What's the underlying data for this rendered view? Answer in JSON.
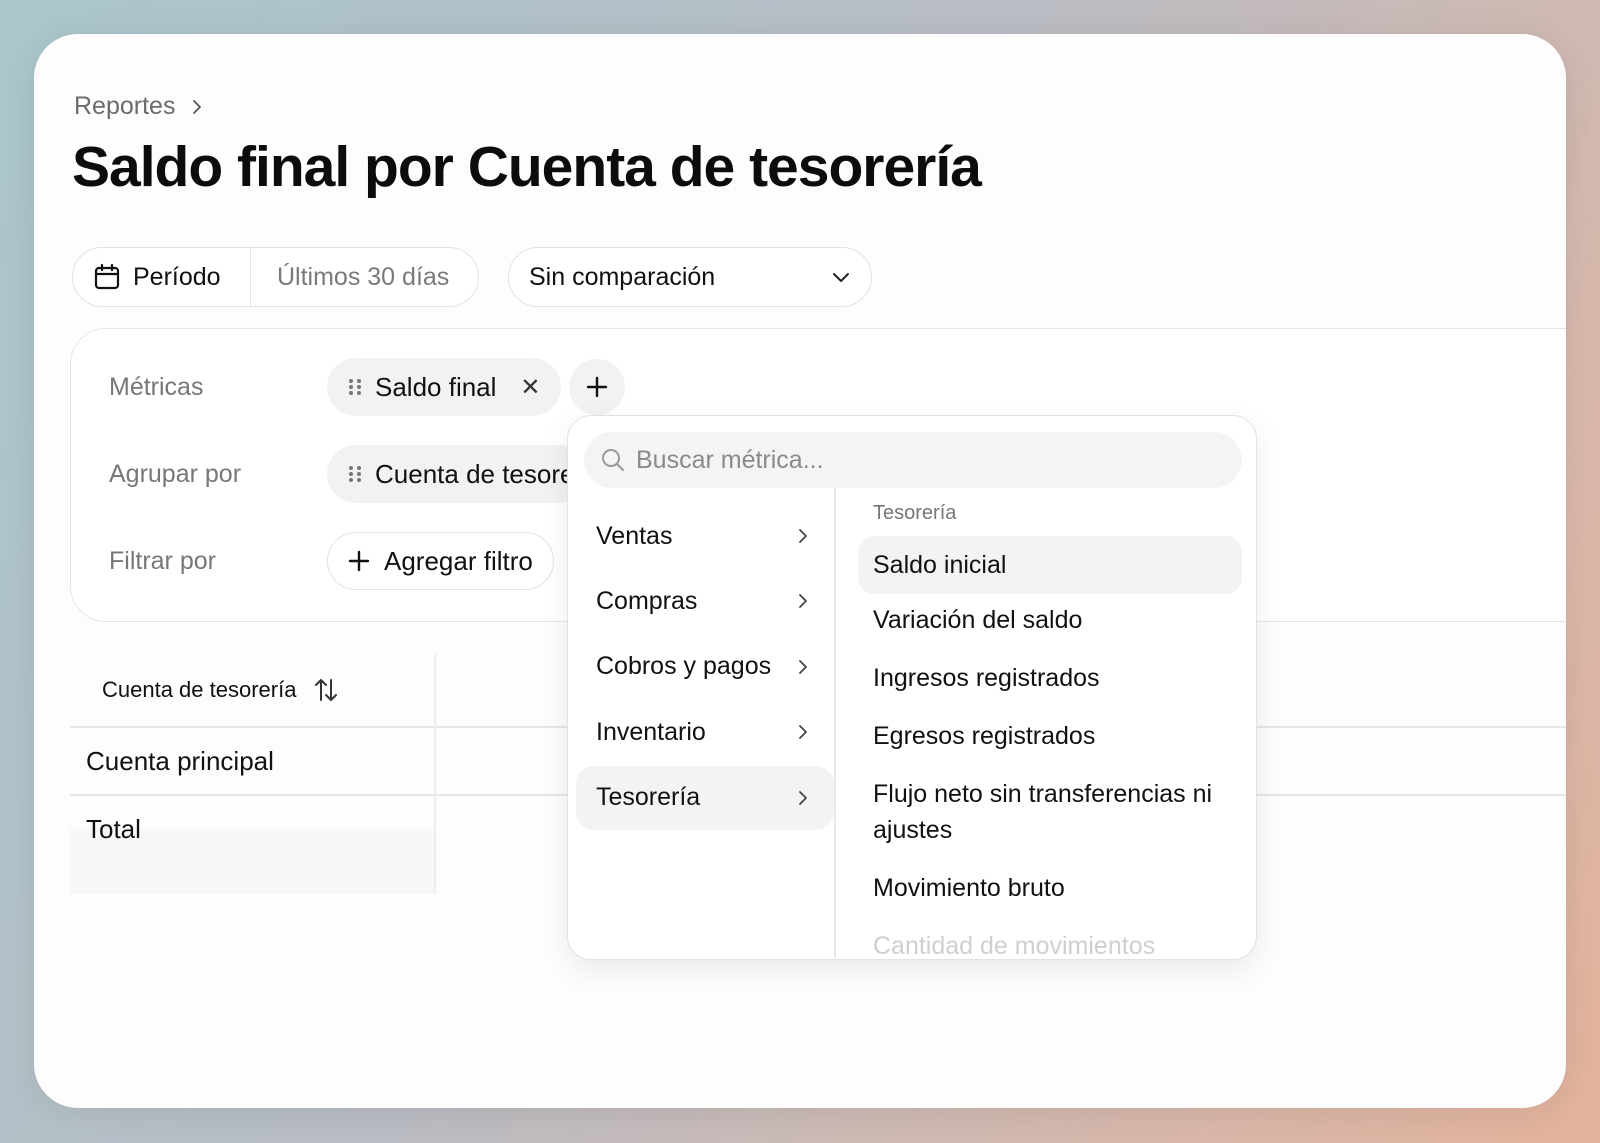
{
  "breadcrumb": {
    "parent": "Reportes"
  },
  "page": {
    "title": "Saldo final por Cuenta de tesorería"
  },
  "period": {
    "label": "Período",
    "value": "Últimos 30 días"
  },
  "comparison": {
    "value": "Sin comparación"
  },
  "config": {
    "metrics_label": "Métricas",
    "group_label": "Agrupar por",
    "filter_label": "Filtrar por",
    "metric_chip": "Saldo final",
    "group_chip": "Cuenta de tesorería",
    "add_filter": "Agregar filtro"
  },
  "table": {
    "header": "Cuenta de tesorería",
    "rows": [
      "Cuenta principal",
      "Total"
    ]
  },
  "dropdown": {
    "search_placeholder": "Buscar métrica...",
    "categories": [
      "Ventas",
      "Compras",
      "Cobros y pagos",
      "Inventario",
      "Tesorería"
    ],
    "active_category": "Tesorería",
    "section_label": "Tesorería",
    "metrics": [
      "Saldo inicial",
      "Variación del saldo",
      "Ingresos registrados",
      "Egresos registrados",
      "Flujo neto sin transferencias ni ajustes",
      "Movimiento bruto",
      "Cantidad de movimientos"
    ]
  }
}
